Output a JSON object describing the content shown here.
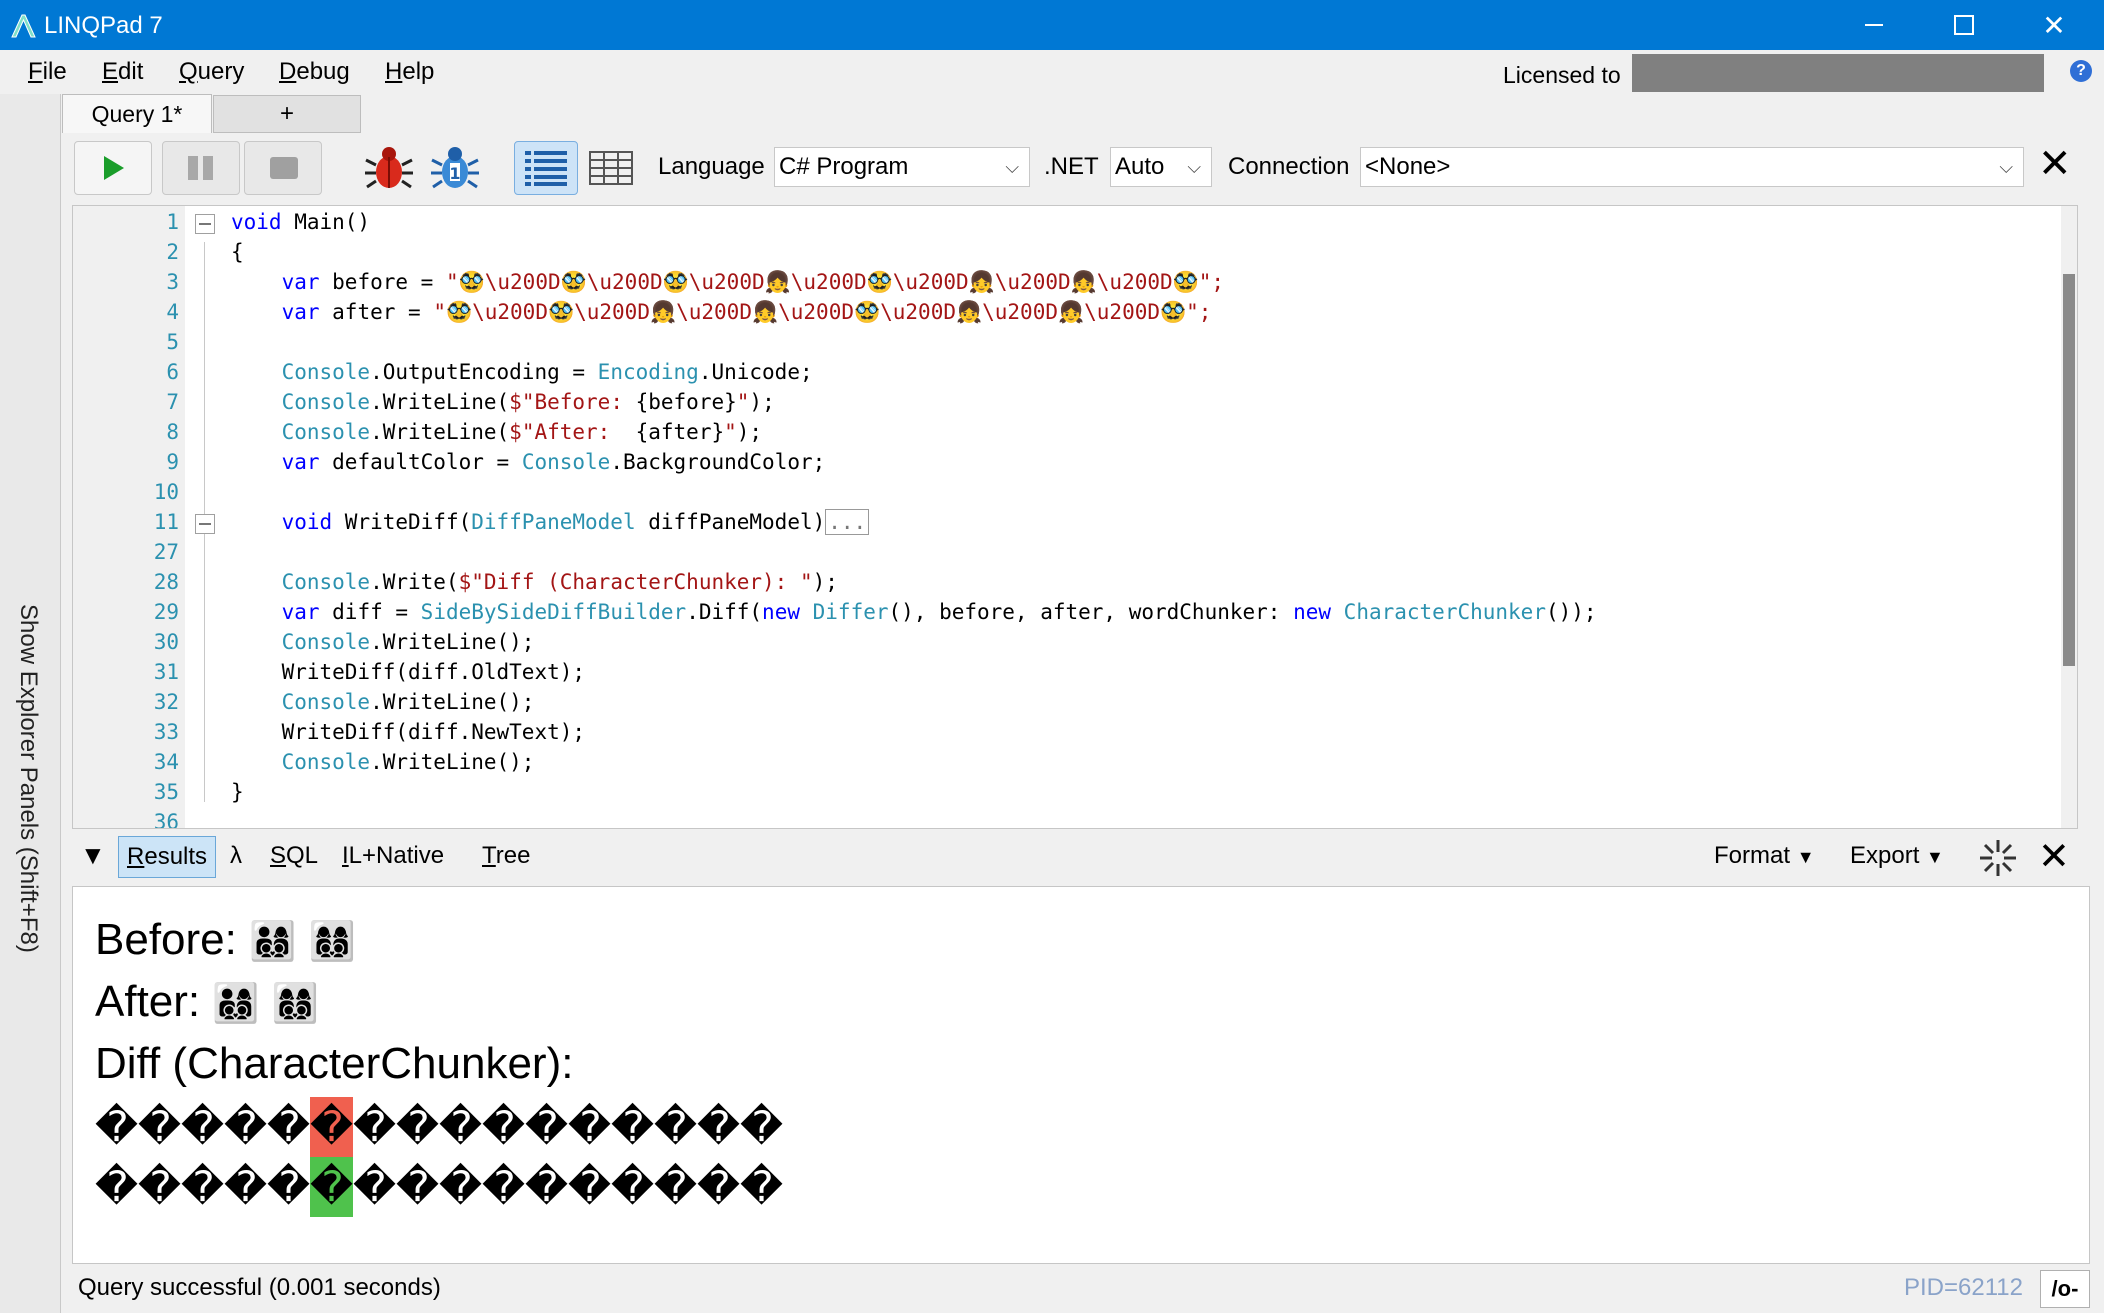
{
  "window": {
    "title": "LINQPad 7",
    "minimize": "—",
    "close": "✕"
  },
  "menu": {
    "file": {
      "u": "F",
      "rest": "ile"
    },
    "edit": {
      "u": "E",
      "rest": "dit"
    },
    "query": {
      "u": "Q",
      "rest": "uery"
    },
    "debug": {
      "u": "D",
      "rest": "ebug"
    },
    "help": {
      "u": "H",
      "rest": "elp"
    },
    "licensed_label": "Licensed to",
    "help_icon": "?"
  },
  "explorer": {
    "label": "Show Explorer Panels  (Shift+F8)"
  },
  "tabs": {
    "query": "Query 1*",
    "new": "+"
  },
  "toolbar": {
    "language_label": "Language",
    "language_value": "C# Program",
    "net_label": ".NET",
    "net_value": "Auto",
    "connection_label": "Connection",
    "connection_value": "<None>",
    "close": "✕",
    "dropdown_arrow": "⌵",
    "icons": [
      "run-icon",
      "pause-icon",
      "stop-icon",
      "debug-bug-icon",
      "debug-step-icon",
      "rich-text-results-icon",
      "grid-results-icon",
      "close-icon"
    ]
  },
  "editor": {
    "line_numbers": [
      "1",
      "2",
      "3",
      "4",
      "5",
      "6",
      "7",
      "8",
      "9",
      "10",
      "11",
      "27",
      "28",
      "29",
      "30",
      "31",
      "32",
      "33",
      "34",
      "35",
      "36"
    ],
    "lines": {
      "l1": [
        "void",
        " Main()"
      ],
      "l2": "{",
      "l3": [
        "var",
        " before = ",
        "\"🥸\\u200D🥸\\u200D🥸\\u200D👧\\u200D🥸\\u200D👧\\u200D👧\\u200D🥸\";"
      ],
      "l4": [
        "var",
        " after = ",
        "\"🥸\\u200D🥸\\u200D👧\\u200D👧\\u200D🥸\\u200D👧\\u200D👧\\u200D🥸\";"
      ],
      "l6": [
        "Console",
        ".OutputEncoding = ",
        "Encoding",
        ".Unicode;"
      ],
      "l7": [
        "Console",
        ".WriteLine(",
        "$\"Before: ",
        "{before}",
        "\"",
        ");"
      ],
      "l8": [
        "Console",
        ".WriteLine(",
        "$\"After:  ",
        "{after}",
        "\"",
        ");"
      ],
      "l9": [
        "var",
        " defaultColor = ",
        "Console",
        ".BackgroundColor;"
      ],
      "l11": [
        "void",
        " WriteDiff(",
        "DiffPaneModel",
        " diffPaneModel)",
        "..."
      ],
      "l28": [
        "Console",
        ".Write(",
        "$\"Diff (CharacterChunker): \"",
        ");"
      ],
      "l29": [
        "var",
        " diff = ",
        "SideBySideDiffBuilder",
        ".Diff(",
        "new",
        " ",
        "Differ",
        "(), before, after, wordChunker: ",
        "new",
        " ",
        "CharacterChunker",
        "());"
      ],
      "l30": [
        "Console",
        ".WriteLine();"
      ],
      "l31": "WriteDiff(diff.OldText);",
      "l32": [
        "Console",
        ".WriteLine();"
      ],
      "l33": "WriteDiff(diff.NewText);",
      "l34": [
        "Console",
        ".WriteLine();"
      ],
      "l35": "}"
    }
  },
  "results_bar": {
    "results": {
      "u": "R",
      "rest": "esults"
    },
    "lambda": "λ",
    "sql": {
      "u": "S",
      "rest": "QL"
    },
    "il": {
      "u": "I",
      "rest": "L+Native"
    },
    "tree": {
      "u": "T",
      "rest": "ree"
    },
    "format": "Format",
    "export": "Export",
    "caret": "▼"
  },
  "output": {
    "before_label": "Before:",
    "before_value": "👨‍👩‍👦‍👦 👩‍👩‍👦‍👦",
    "after_label": "After:",
    "after_value": "👨‍👩‍👦‍👦 👩‍👩‍👦‍👦",
    "diff_label": "Diff (CharacterChunker):",
    "old_chars": [
      "�",
      "�",
      "�",
      "�",
      "�",
      "�",
      "�",
      "�",
      "�",
      "�",
      "�",
      "�",
      "�",
      "�",
      "�",
      "�"
    ],
    "new_chars": [
      "�",
      "�",
      "�",
      "�",
      "�",
      "�",
      "�",
      "�",
      "�",
      "�",
      "�",
      "�",
      "�",
      "�",
      "�",
      "�"
    ],
    "changed_index": 5,
    "colors": {
      "deleted": "#f0604f",
      "inserted": "#4fc24c"
    }
  },
  "status": {
    "text": "Query successful  (0.001 seconds)",
    "pid": "PID=62112",
    "button": "/o-"
  }
}
